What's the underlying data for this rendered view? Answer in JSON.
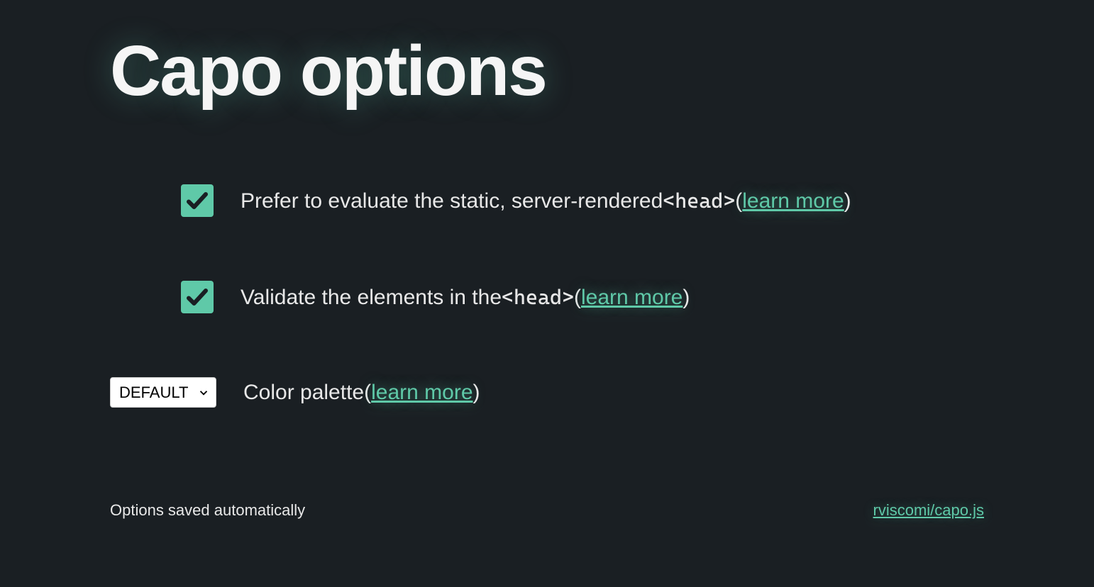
{
  "title": "Capo options",
  "options": {
    "static_eval": {
      "checked": true,
      "label_pre": "Prefer to evaluate the static, server-rendered ",
      "code": "<head>",
      "paren_open": " (",
      "learn_more": "learn more",
      "paren_close": ")"
    },
    "validate": {
      "checked": true,
      "label_pre": "Validate the elements in the ",
      "code": "<head>",
      "paren_open": " (",
      "learn_more": "learn more",
      "paren_close": ")"
    },
    "palette": {
      "selected": "DEFAULT",
      "label_pre": "Color palette ",
      "paren_open": "(",
      "learn_more": "learn more",
      "paren_close": ")"
    }
  },
  "footer": {
    "status": "Options saved automatically",
    "repo_link": "rviscomi/capo.js"
  }
}
